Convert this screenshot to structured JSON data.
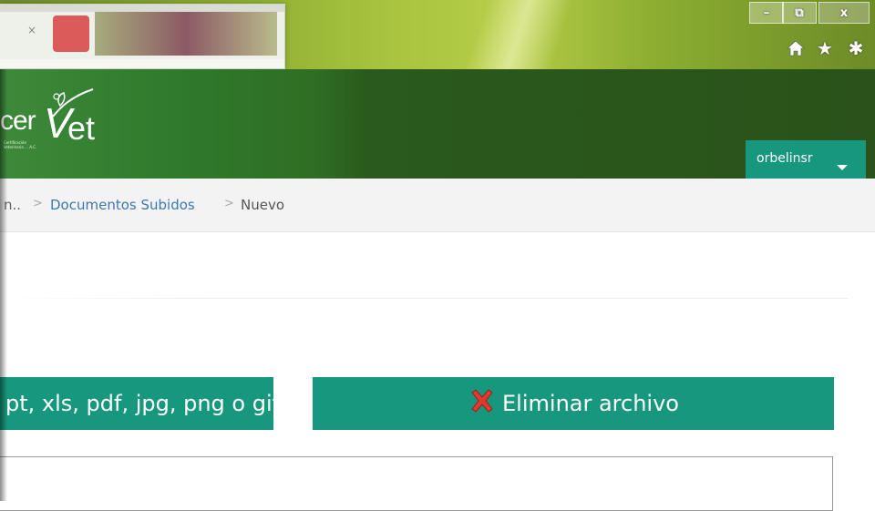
{
  "window": {
    "minimize_label": "–",
    "maximize_label": "⧉",
    "close_label": "x",
    "icons": [
      "home-icon",
      "star-icon",
      "gear-icon"
    ]
  },
  "header": {
    "logo": {
      "text_prefix": "cer",
      "text_v": "V",
      "text_et": "et",
      "small_text": "Certificación Veterinaria ... A.C."
    },
    "user": {
      "name": "orbelinsr"
    }
  },
  "breadcrumb": {
    "items": [
      "n..",
      "Documentos Subidos",
      "Nuevo"
    ],
    "separator": ">"
  },
  "actions": {
    "file_types_label": "pt, xls, pdf, jpg, png o gif",
    "delete_label": "Eliminar archivo"
  },
  "colors": {
    "accent": "#17977e",
    "header_green": "#2a521a",
    "link_blue": "#3a78b0"
  }
}
